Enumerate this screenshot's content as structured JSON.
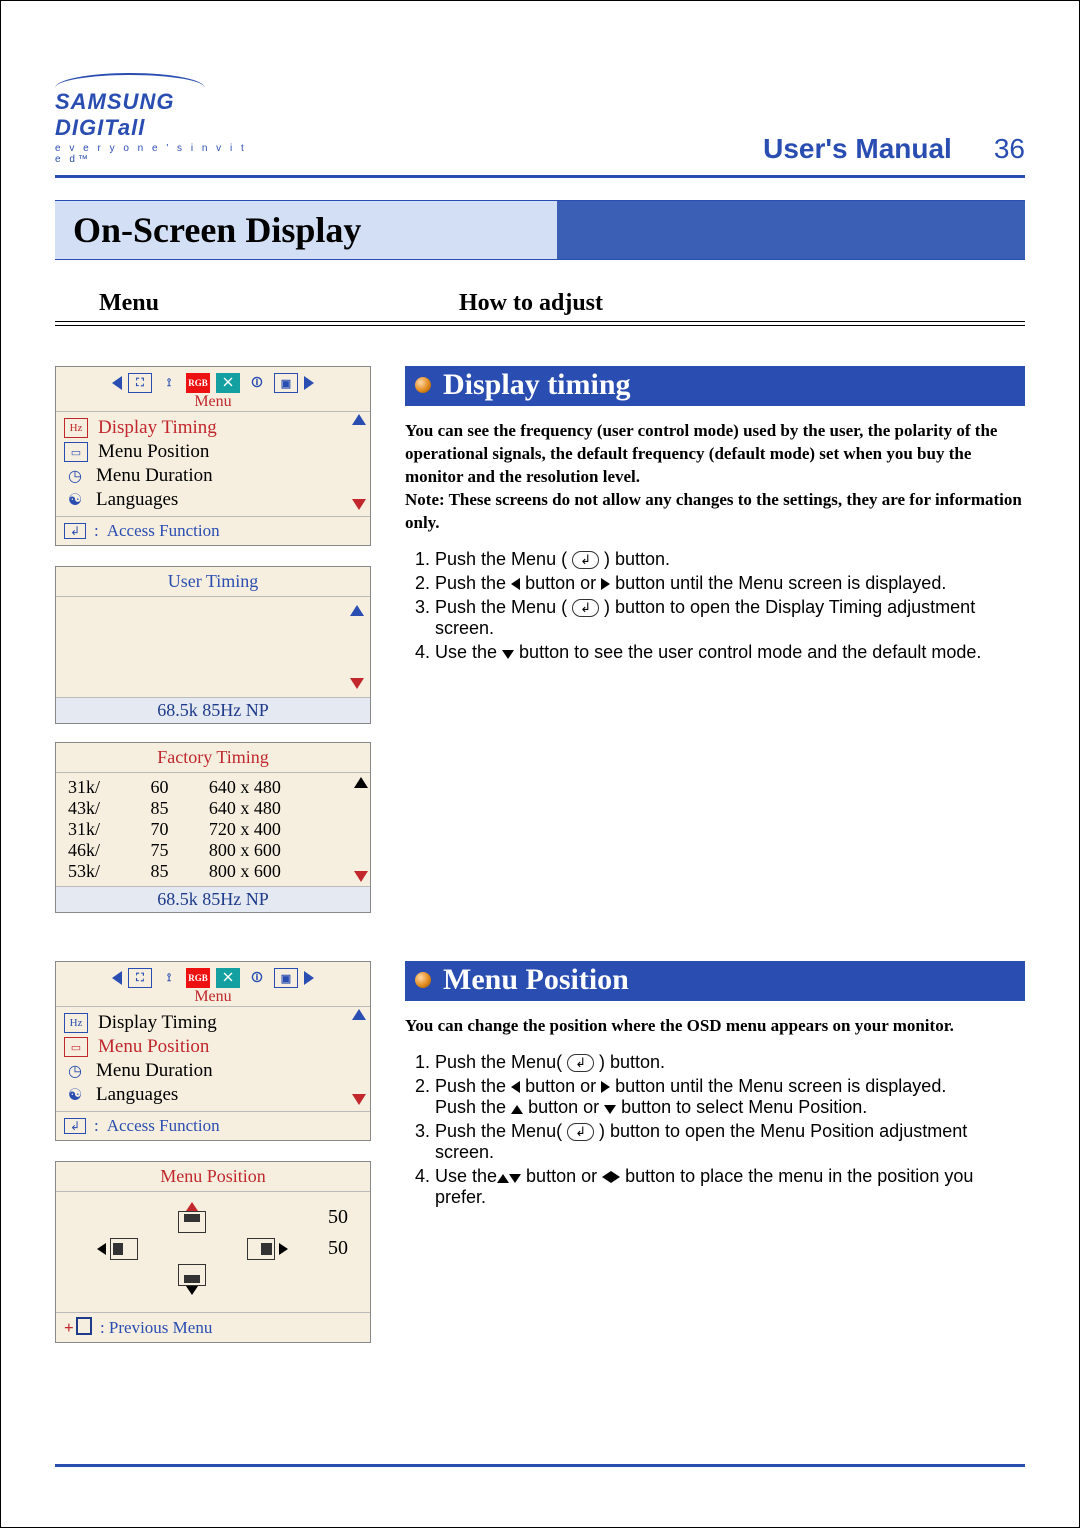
{
  "header": {
    "brand_main": "SAMSUNG DIGIT",
    "brand_suffix1": "all",
    "brand_tag": "e v e r y o n e ' s   i n v i t e d™",
    "title": "User's Manual",
    "page_no": "36"
  },
  "page_title": "On-Screen Display",
  "col_headers": {
    "menu": "Menu",
    "how": "How to adjust"
  },
  "osd_common": {
    "menu_label": "Menu",
    "access_function": "Access Function",
    "previous_menu": "Previous Menu",
    "items": [
      {
        "icon": "Hz",
        "label": "Display Timing"
      },
      {
        "icon": "pos",
        "label": "Menu Position"
      },
      {
        "icon": "clock",
        "label": "Menu Duration"
      },
      {
        "icon": "lang",
        "label": "Languages"
      }
    ]
  },
  "section1": {
    "title": "Display timing",
    "intro1": "You can see the frequency (user control mode) used by the user, the polarity of the operational signals, the default frequency (default mode) set when you buy the monitor and the resolution level.",
    "intro2": "Note: These screens do not allow any changes to the settings, they are for information only.",
    "steps": {
      "s1a": "Push the Menu ( ",
      "s1b": " ) button.",
      "s2a": "Push the ",
      "s2mid": " button or ",
      "s2b": " button until the Menu screen is displayed.",
      "s3a": "Push the Menu ( ",
      "s3b": " ) button to open the Display Timing adjustment screen.",
      "s4a": "Use the ",
      "s4b": " button to see the user control mode and the default mode."
    },
    "user_timing_title": "User Timing",
    "user_timing_status": "68.5k      85Hz   NP",
    "factory_timing_title": "Factory Timing",
    "factory_timing_status": "68.5k      85Hz   NP",
    "factory_rows": [
      {
        "k": "31k/",
        "hz": "60",
        "res": "640 x 480"
      },
      {
        "k": "43k/",
        "hz": "85",
        "res": "640 x 480"
      },
      {
        "k": "31k/",
        "hz": "70",
        "res": "720 x 400"
      },
      {
        "k": "46k/",
        "hz": "75",
        "res": "800 x 600"
      },
      {
        "k": "53k/",
        "hz": "85",
        "res": "800 x 600"
      }
    ]
  },
  "section2": {
    "title": "Menu Position",
    "intro": "You can change the position where the OSD menu appears on your monitor.",
    "steps": {
      "s1a": "Push the Menu( ",
      "s1b": " ) button.",
      "s2a": "Push the ",
      "s2mid": " button or ",
      "s2end": " button until the Menu screen is displayed.",
      "s2line2a": "Push the ",
      "s2line2mid": " button or ",
      "s2line2end": " button to select Menu Position.",
      "s3a": "Push the Menu( ",
      "s3b": " ) button to open the Menu Position adjustment screen.",
      "s4a": "Use the",
      "s4mid": " button or ",
      "s4end": " button to place the menu in the position you prefer."
    },
    "panel_title": "Menu Position",
    "val_h": "50",
    "val_v": "50"
  }
}
